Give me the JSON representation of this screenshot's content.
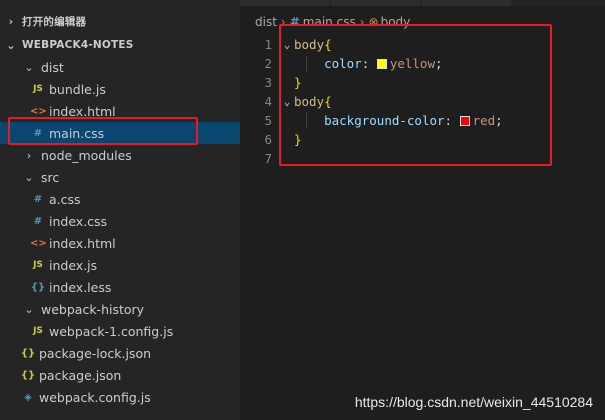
{
  "sidebar": {
    "open_editors_label": "打开的编辑器",
    "project_label": "WEBPACK4-NOTES",
    "tree": [
      {
        "label": "dist",
        "type": "folder",
        "expanded": true,
        "depth": 0,
        "name": "folder-dist",
        "icon": "chevron-down-icon"
      },
      {
        "label": "bundle.js",
        "type": "js",
        "depth": 1,
        "name": "file-bundle-js",
        "icon": "js-file-icon",
        "glyph": "JS"
      },
      {
        "label": "index.html",
        "type": "html",
        "depth": 1,
        "name": "file-index-html",
        "icon": "html-file-icon",
        "glyph": "<>"
      },
      {
        "label": "main.css",
        "type": "css",
        "depth": 1,
        "name": "file-main-css",
        "icon": "css-file-icon",
        "glyph": "#",
        "selected": true
      },
      {
        "label": "node_modules",
        "type": "folder",
        "expanded": false,
        "depth": 0,
        "name": "folder-node-modules",
        "icon": "chevron-right-icon"
      },
      {
        "label": "src",
        "type": "folder",
        "expanded": true,
        "depth": 0,
        "name": "folder-src",
        "icon": "chevron-down-icon"
      },
      {
        "label": "a.css",
        "type": "css",
        "depth": 1,
        "name": "file-a-css",
        "icon": "css-file-icon",
        "glyph": "#"
      },
      {
        "label": "index.css",
        "type": "css",
        "depth": 1,
        "name": "file-index-css",
        "icon": "css-file-icon",
        "glyph": "#"
      },
      {
        "label": "index.html",
        "type": "html",
        "depth": 1,
        "name": "file-src-index-html",
        "icon": "html-file-icon",
        "glyph": "<>"
      },
      {
        "label": "index.js",
        "type": "js",
        "depth": 1,
        "name": "file-index-js",
        "icon": "js-file-icon",
        "glyph": "JS"
      },
      {
        "label": "index.less",
        "type": "less",
        "depth": 1,
        "name": "file-index-less",
        "icon": "less-file-icon",
        "glyph": "{}"
      },
      {
        "label": "webpack-history",
        "type": "folder",
        "expanded": true,
        "depth": 0,
        "name": "folder-webpack-history",
        "icon": "chevron-down-icon"
      },
      {
        "label": "webpack-1.config.js",
        "type": "js",
        "depth": 1,
        "name": "file-webpack-1-config-js",
        "icon": "js-file-icon",
        "glyph": "JS"
      },
      {
        "label": "package-lock.json",
        "type": "json",
        "depth": -1,
        "name": "file-package-lock-json",
        "icon": "json-file-icon",
        "glyph": "{}"
      },
      {
        "label": "package.json",
        "type": "json",
        "depth": -1,
        "name": "file-package-json",
        "icon": "json-file-icon",
        "glyph": "{}"
      },
      {
        "label": "webpack.config.js",
        "type": "cfg",
        "depth": -1,
        "name": "file-webpack-config-js",
        "icon": "webpack-icon",
        "glyph": "◈"
      }
    ]
  },
  "breadcrumb": {
    "folder": "dist",
    "file": "main.css",
    "symbol": "body"
  },
  "code": [
    {
      "n": "1",
      "fold": "⌄",
      "tokens": [
        {
          "t": "body",
          "c": "tok-sel"
        },
        {
          "t": "{",
          "c": "tok-brace"
        }
      ]
    },
    {
      "n": "2",
      "fold": "",
      "tokens": [
        {
          "t": "    ",
          "c": "tok-punc"
        },
        {
          "t": "color",
          "c": "tok-prop"
        },
        {
          "t": ": ",
          "c": "tok-punc"
        },
        {
          "swatch": "#ffff00"
        },
        {
          "t": "yellow",
          "c": "tok-val"
        },
        {
          "t": ";",
          "c": "tok-punc"
        }
      ]
    },
    {
      "n": "3",
      "fold": "",
      "tokens": [
        {
          "t": "}",
          "c": "tok-brace"
        }
      ]
    },
    {
      "n": "4",
      "fold": "⌄",
      "tokens": [
        {
          "t": "body",
          "c": "tok-sel"
        },
        {
          "t": "{",
          "c": "tok-brace"
        }
      ]
    },
    {
      "n": "5",
      "fold": "",
      "tokens": [
        {
          "t": "    ",
          "c": "tok-punc"
        },
        {
          "t": "background-color",
          "c": "tok-prop"
        },
        {
          "t": ": ",
          "c": "tok-punc"
        },
        {
          "swatch": "#ff0000"
        },
        {
          "t": "red",
          "c": "tok-val"
        },
        {
          "t": ";",
          "c": "tok-punc"
        }
      ]
    },
    {
      "n": "6",
      "fold": "",
      "tokens": [
        {
          "t": "}",
          "c": "tok-brace"
        }
      ]
    },
    {
      "n": "7",
      "fold": "",
      "tokens": []
    }
  ],
  "watermark": "https://blog.csdn.net/weixin_44510284",
  "colors": {
    "highlight_box": "#e51c23",
    "selection": "#094771"
  }
}
